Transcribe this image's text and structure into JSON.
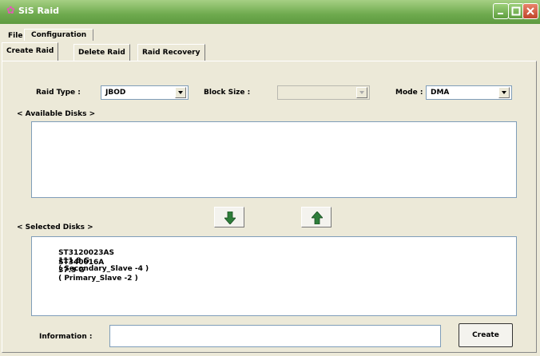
{
  "window": {
    "title": "SiS Raid"
  },
  "menu": {
    "file": "File",
    "configuration": "Configuration"
  },
  "tabs": {
    "create": "Create Raid",
    "delete": "Delete Raid",
    "recovery": "Raid Recovery"
  },
  "form": {
    "raid_type_label": "Raid Type :",
    "raid_type_value": "JBOD",
    "block_size_label": "Block Size :",
    "block_size_value": "",
    "mode_label": "Mode :",
    "mode_value": "DMA"
  },
  "available": {
    "label": "< Available Disks >",
    "items": []
  },
  "selected": {
    "label": "< Selected Disks >",
    "items": [
      {
        "model": "ST3120023AS",
        "size": "111.8 G",
        "location": "( Secondary_Slave -4 )"
      },
      {
        "model": "ST340016A",
        "size": "37.3 G",
        "location": "( Primary_Slave -2 )"
      }
    ]
  },
  "information": {
    "label": "Information :",
    "value": ""
  },
  "buttons": {
    "create": "Create"
  },
  "colors": {
    "titlebar": "#6eaa4e",
    "window_bg": "#ece9d8",
    "arrow_down": "#2e7d3a",
    "arrow_up": "#2e7d3a"
  }
}
